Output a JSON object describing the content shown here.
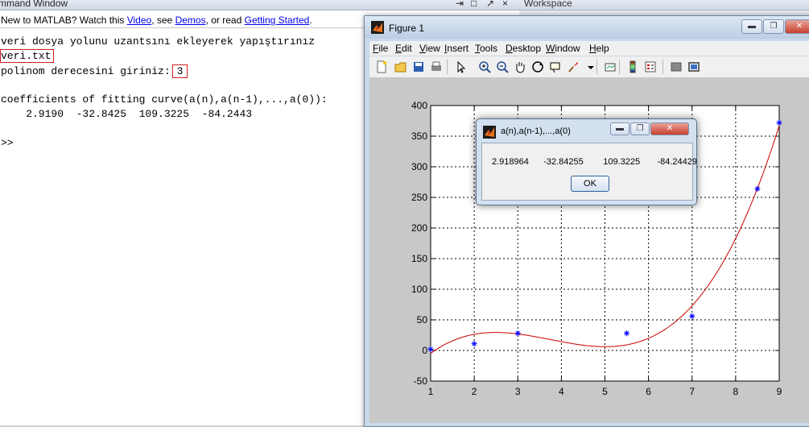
{
  "command_window": {
    "title": "mmand Window",
    "new_bar": {
      "prefix": "New to MATLAB? Watch this ",
      "video": "Video",
      "sep1": ", see ",
      "demos": "Demos",
      "sep2": ", or read ",
      "getting_started": "Getting Started",
      "suffix": "."
    },
    "lines": [
      "veri dosya yolunu uzantsını ekleyerek yapıştırınız",
      "veri.txt",
      "polinom derecesini giriniz:",
      "3",
      "coefficients of fitting curve(a(n),a(n-1),...,a(0)):",
      "    2.9190  -32.8425  109.3225  -84.2443",
      ">>"
    ]
  },
  "workspace": {
    "title": "Workspace"
  },
  "figure": {
    "title": "Figure 1",
    "menus": [
      {
        "u": "F",
        "rest": "ile"
      },
      {
        "u": "E",
        "rest": "dit"
      },
      {
        "u": "V",
        "rest": "iew"
      },
      {
        "u": "I",
        "rest": "nsert"
      },
      {
        "u": "T",
        "rest": "ools"
      },
      {
        "u": "D",
        "rest": "esktop"
      },
      {
        "u": "W",
        "rest": "indow"
      },
      {
        "u": "H",
        "rest": "elp"
      }
    ],
    "toolbar_icons": [
      "new-file-icon",
      "open-folder-icon",
      "save-icon",
      "print-icon",
      "pointer-icon",
      "zoom-in-icon",
      "zoom-out-icon",
      "pan-hand-icon",
      "rotate-3d-icon",
      "data-cursor-icon",
      "brush-icon",
      "brush-dropdown-icon",
      "link-plot-icon",
      "colorbar-icon",
      "legend-icon",
      "hide-plot-tools-icon",
      "show-plot-tools-icon"
    ]
  },
  "dialog": {
    "title": "a(n),a(n-1),...,a(0)",
    "message": "2.918964      -32.84255        109.3225       -84.24429",
    "ok_label": "OK"
  },
  "colors": {
    "curve": "#cc0000",
    "points": "#0000ff"
  },
  "chart_data": {
    "type": "scatter",
    "title": "",
    "xlabel": "",
    "ylabel": "",
    "xlim": [
      1,
      9
    ],
    "ylim": [
      -50,
      400
    ],
    "xticks": [
      1,
      2,
      3,
      4,
      5,
      6,
      7,
      8,
      9
    ],
    "yticks": [
      -50,
      0,
      50,
      100,
      150,
      200,
      250,
      300,
      350,
      400
    ],
    "grid": true,
    "grid_style": "dotted",
    "series": [
      {
        "marker": "*",
        "color": "#0000ff",
        "x": [
          1,
          2,
          3,
          5.5,
          7,
          8.5,
          9
        ],
        "y": [
          2,
          11,
          28,
          28,
          56,
          264,
          372
        ]
      }
    ],
    "fit_curve": {
      "color": "#cc0000",
      "coefficients": [
        2.918964,
        -32.84255,
        109.3225,
        -84.24429
      ],
      "x_range": [
        1,
        9
      ]
    }
  }
}
